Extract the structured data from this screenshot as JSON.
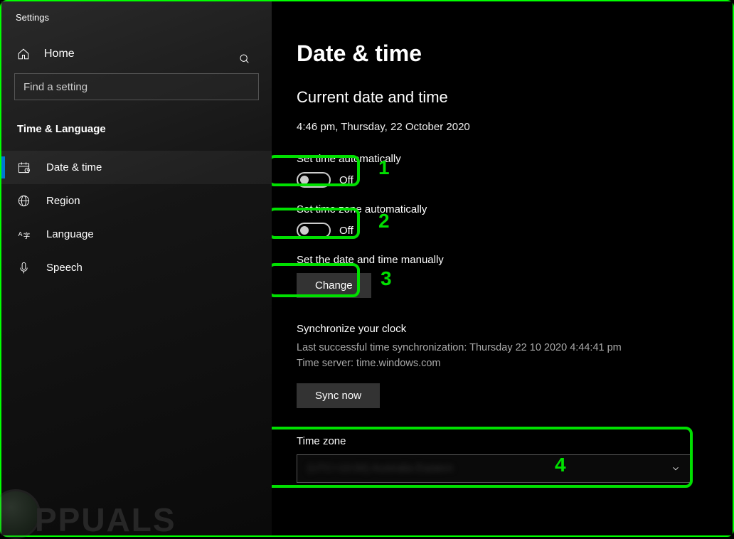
{
  "window": {
    "title": "Settings"
  },
  "sidebar": {
    "home": "Home",
    "search_placeholder": "Find a setting",
    "section": "Time & Language",
    "items": [
      {
        "label": "Date & time",
        "icon": "calendar-icon",
        "active": true
      },
      {
        "label": "Region",
        "icon": "globe-icon",
        "active": false
      },
      {
        "label": "Language",
        "icon": "language-icon",
        "active": false
      },
      {
        "label": "Speech",
        "icon": "mic-icon",
        "active": false
      }
    ]
  },
  "main": {
    "title": "Date & time",
    "current_header": "Current date and time",
    "current_value": "4:46 pm, Thursday, 22 October 2020",
    "set_time_auto": {
      "label": "Set time automatically",
      "state": "Off"
    },
    "set_tz_auto": {
      "label": "Set time zone automatically",
      "state": "Off"
    },
    "manual": {
      "label": "Set the date and time manually",
      "button": "Change"
    },
    "sync": {
      "title": "Synchronize your clock",
      "last": "Last successful time synchronization: Thursday 22 10 2020 4:44:41 pm",
      "server": "Time server: time.windows.com",
      "button": "Sync now"
    },
    "tz": {
      "label": "Time zone",
      "value": "(UTC+10:00) Australia Eastern"
    }
  },
  "annotations": {
    "n1": "1",
    "n2": "2",
    "n3": "3",
    "n4": "4"
  },
  "watermark": "PPUALS"
}
